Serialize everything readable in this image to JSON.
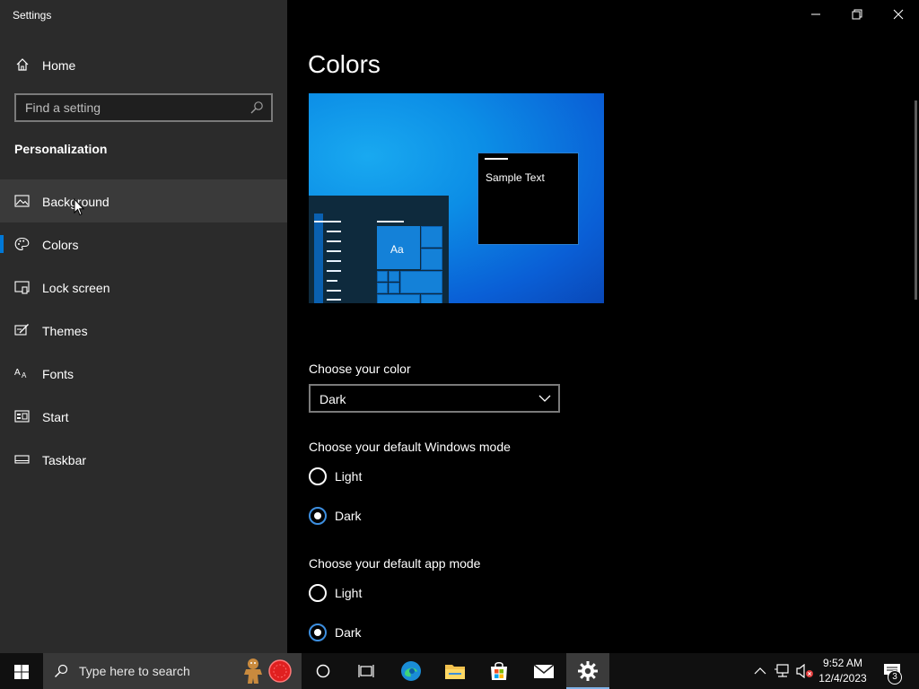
{
  "window": {
    "title": "Settings"
  },
  "sidebar": {
    "home_label": "Home",
    "search_placeholder": "Find a setting",
    "section_title": "Personalization",
    "items": [
      {
        "label": "Background",
        "icon": "picture-icon"
      },
      {
        "label": "Colors",
        "icon": "palette-icon"
      },
      {
        "label": "Lock screen",
        "icon": "lock-screen-icon"
      },
      {
        "label": "Themes",
        "icon": "themes-icon"
      },
      {
        "label": "Fonts",
        "icon": "fonts-icon"
      },
      {
        "label": "Start",
        "icon": "start-icon"
      },
      {
        "label": "Taskbar",
        "icon": "taskbar-icon"
      }
    ],
    "selected": "Colors",
    "hovered": "Background"
  },
  "main": {
    "title": "Colors",
    "preview": {
      "sample_text": "Sample Text",
      "tile_label": "Aa"
    },
    "choose_color": {
      "label": "Choose your color",
      "value": "Dark"
    },
    "windows_mode": {
      "label": "Choose your default Windows mode",
      "options": [
        "Light",
        "Dark"
      ],
      "selected": "Dark"
    },
    "app_mode": {
      "label": "Choose your default app mode",
      "options": [
        "Light",
        "Dark"
      ],
      "selected": "Dark"
    }
  },
  "taskbar": {
    "search_placeholder": "Type here to search",
    "time": "9:52 AM",
    "date": "12/4/2023",
    "notification_count": "3"
  },
  "colors": {
    "accent": "#0078d7",
    "sidebar_bg": "#2b2b2b",
    "main_bg": "#000000"
  }
}
